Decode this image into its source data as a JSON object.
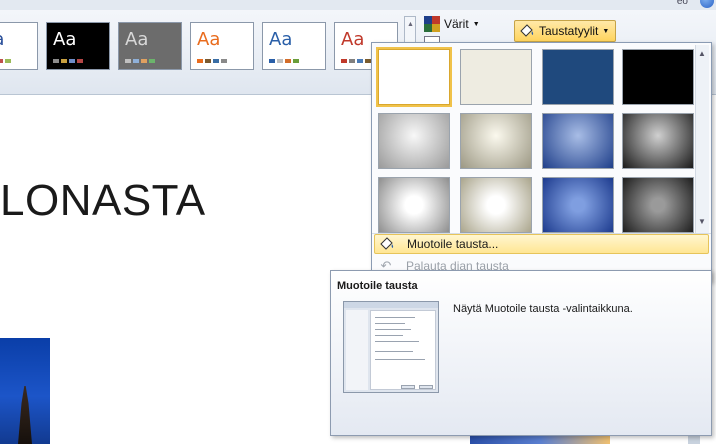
{
  "ribbon": {
    "close_text": "eo",
    "themes": [
      {
        "name": "theme-office",
        "aa": "Aa",
        "bg": "#ffffff",
        "fg": "#2a4f9a",
        "swatches": [
          "#f6c23e",
          "#4472c4",
          "#c0504d",
          "#9bbb59"
        ]
      },
      {
        "name": "theme-dark",
        "aa": "Aa",
        "bg": "#000000",
        "fg": "#ffffff",
        "swatches": [
          "#8c8c8c",
          "#c8a040",
          "#6e8cc8",
          "#b44646"
        ]
      },
      {
        "name": "theme-gray",
        "aa": "Aa",
        "bg": "#6c6c6c",
        "fg": "#d8d8d8",
        "swatches": [
          "#c0c0c0",
          "#8fb0d8",
          "#e0a060",
          "#6bb46b"
        ]
      },
      {
        "name": "theme-orange",
        "aa": "Aa",
        "bg": "#ffffff",
        "fg": "#e96c1e",
        "swatches": [
          "#e96c1e",
          "#7a5a30",
          "#3a6ea5",
          "#8a8a8a"
        ]
      },
      {
        "name": "theme-blue",
        "aa": "Aa",
        "bg": "#ffffff",
        "fg": "#2a5fa8",
        "swatches": [
          "#2a5fa8",
          "#c0c0c0",
          "#d36d2a",
          "#6a9e3a"
        ]
      },
      {
        "name": "theme-red",
        "aa": "Aa",
        "bg": "#ffffff",
        "fg": "#c0392b",
        "swatches": [
          "#c0392b",
          "#808080",
          "#4a7bb7",
          "#7a5c2e"
        ]
      }
    ],
    "colors_label": "Värit",
    "background_styles_label": "Taustatyylit"
  },
  "slide": {
    "title": "LONASTA"
  },
  "background_styles": [
    {
      "name": "bg-style-white",
      "fill": "#ffffff",
      "selected": true
    },
    {
      "name": "bg-style-cream",
      "fill": "#eeece1",
      "selected": false
    },
    {
      "name": "bg-style-navy",
      "fill": "#1f497d",
      "selected": false
    },
    {
      "name": "bg-style-black",
      "fill": "#000000",
      "selected": false
    },
    {
      "name": "bg-style-gray-gradient",
      "fill": "radial-gradient(circle at 50% 40%, #f8f8f8, #9a9a9a)",
      "selected": false
    },
    {
      "name": "bg-style-beige-gradient",
      "fill": "radial-gradient(circle at 50% 40%, #fbf9ee, #9c9884)",
      "selected": false
    },
    {
      "name": "bg-style-blue-gradient",
      "fill": "radial-gradient(circle at 50% 40%, #a8bde6, #1f3f8a)",
      "selected": false
    },
    {
      "name": "bg-style-dark-gradient",
      "fill": "radial-gradient(circle at 50% 40%, #d0d0d0, #1a1a1a)",
      "selected": false
    },
    {
      "name": "bg-style-silver-radial",
      "fill": "radial-gradient(circle at 50% 50%, #ffffff 20%, #8e8e8e)",
      "selected": false
    },
    {
      "name": "bg-style-ivory-radial",
      "fill": "radial-gradient(circle at 50% 50%, #ffffff 20%, #aaa58c)",
      "selected": false
    },
    {
      "name": "bg-style-royal-radial",
      "fill": "radial-gradient(circle at 50% 50%, #7f9ee0 15%, #1d3b8e)",
      "selected": false
    },
    {
      "name": "bg-style-charcoal-radial",
      "fill": "radial-gradient(circle at 50% 50%, #9a9a9a 15%, #1e1e1e)",
      "selected": false
    }
  ],
  "menu": {
    "format_background": "Muotoile tausta...",
    "reset_background": "Palauta dian tausta"
  },
  "tooltip": {
    "title": "Muotoile tausta",
    "description": "Näytä Muotoile tausta -valintaikkuna."
  },
  "colors": {
    "hover_bg": "#ffe694",
    "accent_border": "#e6c45a"
  }
}
